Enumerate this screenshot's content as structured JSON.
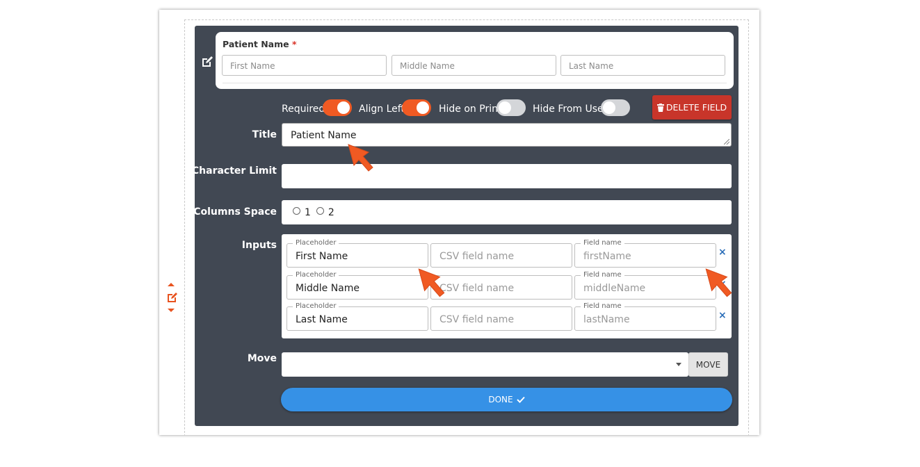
{
  "preview": {
    "label": "Patient Name",
    "required_mark": "*",
    "inputs": [
      "First Name",
      "Middle Name",
      "Last Name"
    ]
  },
  "options": [
    {
      "label": "Required",
      "state": "on"
    },
    {
      "label": "Align Left",
      "state": "on"
    },
    {
      "label": "Hide on Print",
      "state": "off"
    },
    {
      "label": "Hide From User",
      "state": "off"
    }
  ],
  "delete_label": "DELETE FIELD",
  "form": {
    "title_label": "Title",
    "title_value": "Patient Name",
    "char_limit_label": "Character Limit",
    "char_limit_value": "",
    "columns_label": "Columns Space",
    "columns_options": [
      "1",
      "2"
    ],
    "inputs_label": "Inputs",
    "move_label": "Move",
    "move_value": ""
  },
  "inputs_rows": [
    {
      "placeholder_caption": "Placeholder",
      "placeholder": "First Name",
      "csv": "CSV field name",
      "field_caption": "Field name",
      "field": "firstName"
    },
    {
      "placeholder_caption": "Placeholder",
      "placeholder": "Middle Name",
      "csv": "CSV field name",
      "field_caption": "Field name",
      "field": "middleName"
    },
    {
      "placeholder_caption": "Placeholder",
      "placeholder": "Last Name",
      "csv": "CSV field name",
      "field_caption": "Field name",
      "field": "lastName"
    }
  ],
  "remove_glyph": "×",
  "move_button": "MOVE",
  "done_label": "DONE",
  "colors": {
    "panel": "#414853",
    "toggle_on": "#f05a23",
    "delete": "#c8352a",
    "done": "#3691e6",
    "annotation_arrow": "#f05a23"
  }
}
